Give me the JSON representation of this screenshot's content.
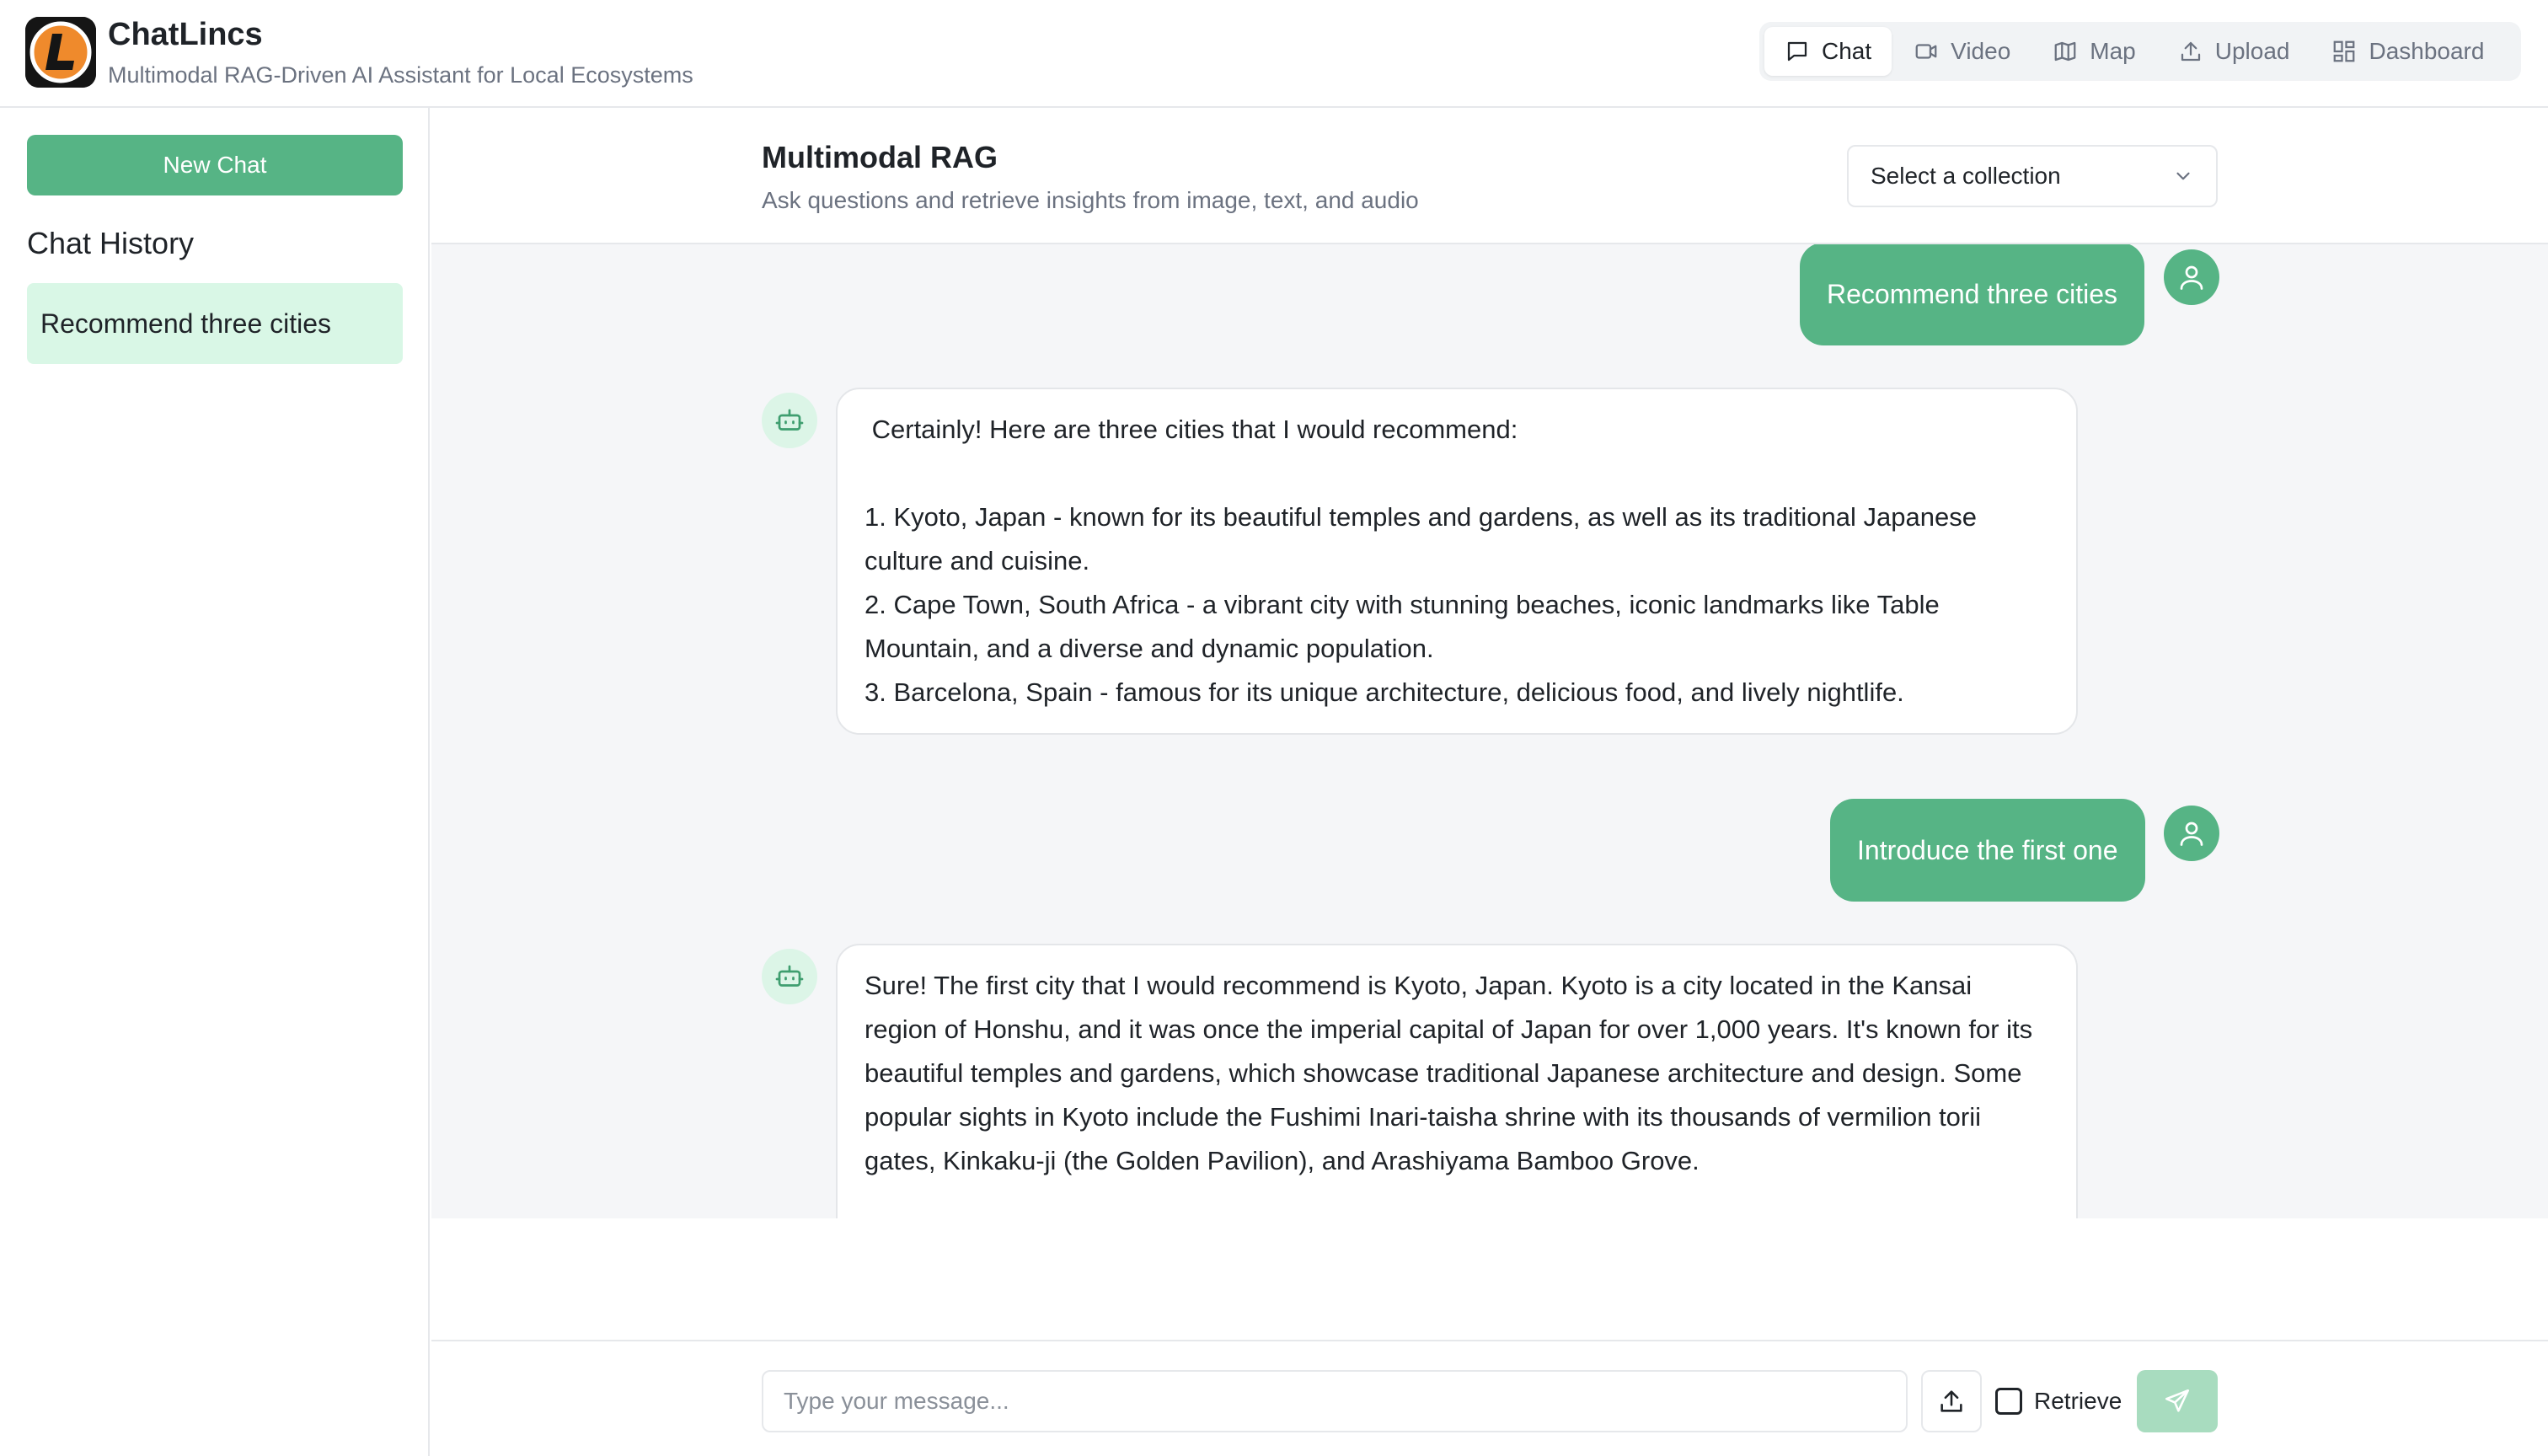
{
  "app": {
    "title": "ChatLincs",
    "subtitle": "Multimodal RAG-Driven AI Assistant for Local Ecosystems"
  },
  "nav": {
    "items": [
      {
        "label": "Chat",
        "icon": "chat-icon",
        "active": true
      },
      {
        "label": "Video",
        "icon": "video-icon",
        "active": false
      },
      {
        "label": "Map",
        "icon": "map-icon",
        "active": false
      },
      {
        "label": "Upload",
        "icon": "upload-icon",
        "active": false
      },
      {
        "label": "Dashboard",
        "icon": "dashboard-icon",
        "active": false
      }
    ]
  },
  "sidebar": {
    "new_chat_label": "New Chat",
    "history_title": "Chat History",
    "history_items": [
      "Recommend three cities"
    ]
  },
  "main": {
    "title": "Multimodal RAG",
    "subtitle": "Ask questions and retrieve insights from image, text, and audio",
    "collection_select": {
      "selected": "Select a collection"
    }
  },
  "messages": [
    {
      "role": "user",
      "text": "Recommend three cities"
    },
    {
      "role": "assistant",
      "lines": [
        " Certainly! Here are three cities that I would recommend:",
        "",
        "1. Kyoto, Japan - known for its beautiful temples and gardens, as well as its traditional Japanese culture and cuisine.",
        "2. Cape Town, South Africa - a vibrant city with stunning beaches, iconic landmarks like Table Mountain, and a diverse and dynamic population.",
        "3. Barcelona, Spain - famous for its unique architecture, delicious food, and lively nightlife."
      ]
    },
    {
      "role": "user",
      "text": "Introduce the first one"
    },
    {
      "role": "assistant",
      "lines": [
        " Sure! The first city that I would recommend is Kyoto, Japan. Kyoto is a city located in the Kansai region of Honshu, and it was once the imperial capital of Japan for over 1,000 years. It's known for its beautiful temples and gardens, which showcase traditional Japanese architecture and design. Some popular sights in Kyoto include the Fushimi Inari-taisha shrine with its thousands of vermilion torii gates, Kinkaku-ji (the Golden Pavilion), and Arashiyama Bamboo Grove."
      ]
    }
  ],
  "composer": {
    "placeholder": "Type your message...",
    "retrieve_label": "Retrieve",
    "retrieve_checked": false
  },
  "colors": {
    "accent": "#56b485",
    "accent_light": "#d9f7e6",
    "send_disabled": "#a8dcbf",
    "chat_bg": "#f5f6f8"
  }
}
